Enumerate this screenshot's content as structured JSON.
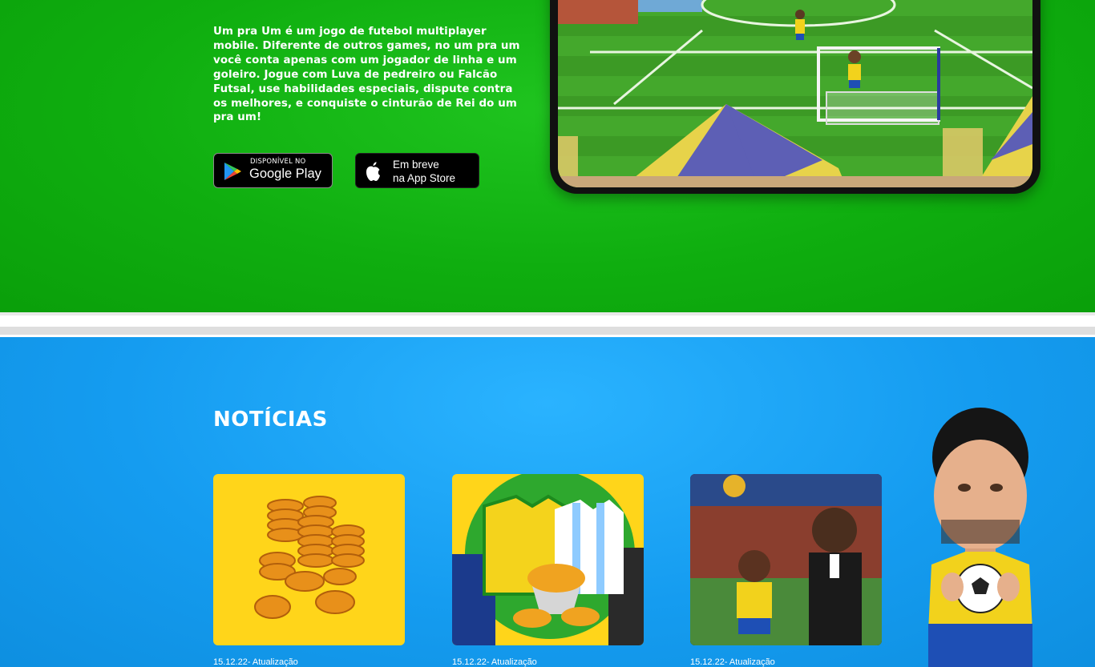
{
  "hero": {
    "description": "Um pra Um é um jogo de futebol multiplayer mobile. Diferente de outros games, no um pra um você conta apenas com um jogador de linha e um goleiro. Jogue com Luva de pedreiro ou Falcão Futsal, use habilidades especiais, dispute contra os melhores, e conquiste o cinturão de Rei do um pra um!",
    "google_play": {
      "small": "DISPONÍVEL NO",
      "big": "Google Play"
    },
    "app_store": {
      "line1": "Em breve",
      "line2": "na App Store"
    }
  },
  "news": {
    "title": "NOTÍCIAS",
    "items": [
      {
        "date": "15.12.22- Atualização"
      },
      {
        "date": "15.12.22- Atualização"
      },
      {
        "date": "15.12.22- Atualização"
      }
    ]
  },
  "colors": {
    "hero_green": "#0fae0f",
    "news_blue": "#159cf0",
    "card_yellow": "#ffd51a"
  }
}
